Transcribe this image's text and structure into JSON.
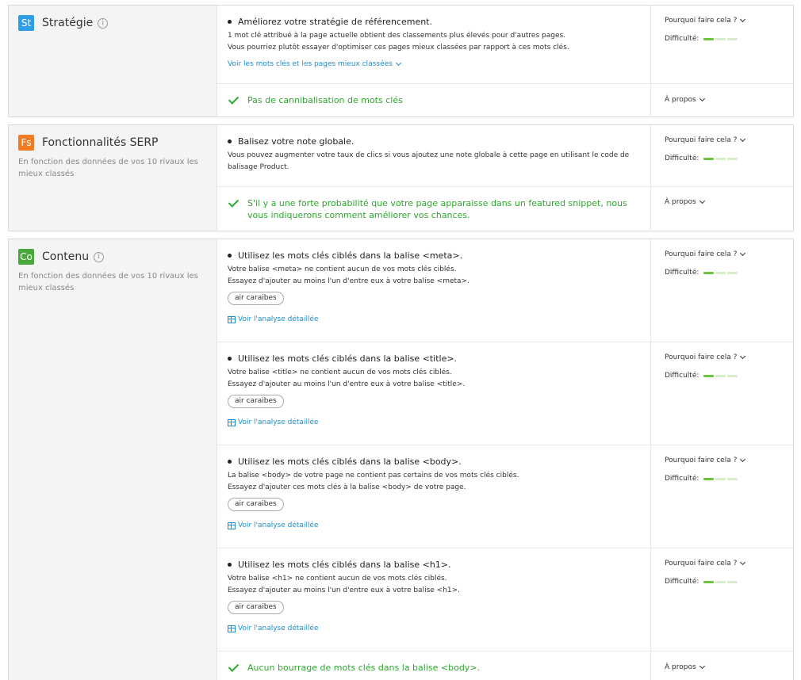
{
  "colors": {
    "strategy_badge": "#2f9ee8",
    "serp_badge": "#f07b22",
    "content_badge": "#46a93a",
    "success": "#2da82d",
    "link": "#1a8fd1",
    "difficulty_active": "#6cc63a",
    "difficulty_inactive": "#d7efc9"
  },
  "labels": {
    "why": "Pourquoi faire cela ?",
    "difficulty": "Difficulté:",
    "about": "À propos",
    "detailed": "Voir l'analyse détaillée"
  },
  "sections": [
    {
      "badge": "St",
      "title": "Stratégie",
      "description": "",
      "rows": [
        {
          "title": "Améliorez votre stratégie de référencement.",
          "body1": "1 mot clé attribué à la page actuelle obtient des classements plus élevés pour d'autres pages.",
          "body2": "Vous pourriez plutôt essayer d'optimiser ces pages mieux classées par rapport à ces mots clés.",
          "link": "Voir les mots clés et les pages mieux classées",
          "difficulty": 1
        },
        {
          "ok": "Pas de cannibalisation de mots clés"
        }
      ]
    },
    {
      "badge": "Fs",
      "title": "Fonctionnalités SERP",
      "description": "En fonction des données de vos 10 rivaux les mieux classés",
      "rows": [
        {
          "title": "Balisez votre note globale.",
          "body1": "Vous pouvez augmenter votre taux de clics si vous ajoutez une note globale à cette page en utilisant le code de balisage Product.",
          "difficulty": 1
        },
        {
          "ok": "S'il y a une forte probabilité que votre page apparaisse dans un featured snippet, nous vous indiquerons comment améliorer vos chances."
        }
      ]
    },
    {
      "badge": "Co",
      "title": "Contenu",
      "description": "En fonction des données de vos 10 rivaux les mieux classés",
      "rows": [
        {
          "title": "Utilisez les mots clés ciblés dans la balise <meta>.",
          "body1": "Votre balise <meta> ne contient aucun de vos mots clés ciblés.",
          "body2": "Essayez d'ajouter au moins l'un d'entre eux à votre balise <meta>.",
          "chip": "air caraibes",
          "difficulty": 1
        },
        {
          "title": "Utilisez les mots clés ciblés dans la balise <title>.",
          "body1": "Votre balise <title> ne contient aucun de vos mots clés ciblés.",
          "body2": "Essayez d'ajouter au moins l'un d'entre eux à votre balise <title>.",
          "chip": "air caraibes",
          "difficulty": 1
        },
        {
          "title": "Utilisez les mots clés ciblés dans la balise <body>.",
          "body1": "La balise <body> de votre page ne contient pas certains de vos mots clés ciblés.",
          "body2": "Essayez d'ajouter ces mots clés à la balise <body> de votre page.",
          "chip": "air caraibes",
          "difficulty": 1
        },
        {
          "title": "Utilisez les mots clés ciblés dans la balise <h1>.",
          "body1": "Votre balise <h1> ne contient aucun de vos mots clés ciblés.",
          "body2": "Essayez d'ajouter au moins l'un d'entre eux à votre balise <h1>.",
          "chip": "air caraibes",
          "difficulty": 1
        },
        {
          "ok": "Aucun bourrage de mots clés dans la balise <body>."
        }
      ]
    }
  ]
}
